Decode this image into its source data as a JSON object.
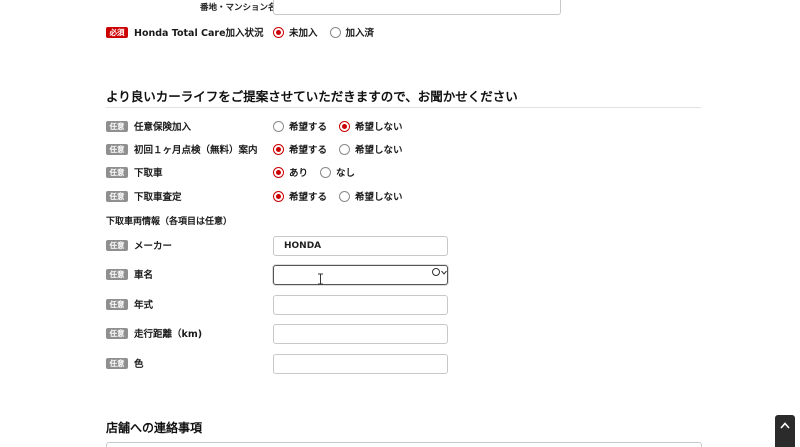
{
  "address": {
    "label": "番地・マンション名",
    "value": ""
  },
  "honda_care": {
    "badge": "必須",
    "label": "Honda Total Care加入状況",
    "options": [
      {
        "label": "未加入",
        "selected": true
      },
      {
        "label": "加入済",
        "selected": false
      }
    ]
  },
  "section": {
    "title": "より良いカーライフをご提案させていただきますので、お聞かせください"
  },
  "rows": [
    {
      "badge": "任意",
      "label": "任意保険加入",
      "options": [
        {
          "label": "希望する",
          "selected": false
        },
        {
          "label": "希望しない",
          "selected": true
        }
      ]
    },
    {
      "badge": "任意",
      "label": "初回１ヶ月点検（無料）案内",
      "options": [
        {
          "label": "希望する",
          "selected": true
        },
        {
          "label": "希望しない",
          "selected": false
        }
      ]
    },
    {
      "badge": "任意",
      "label": "下取車",
      "options": [
        {
          "label": "あり",
          "selected": true
        },
        {
          "label": "なし",
          "selected": false
        }
      ]
    },
    {
      "badge": "任意",
      "label": "下取車査定",
      "options": [
        {
          "label": "希望する",
          "selected": true
        },
        {
          "label": "希望しない",
          "selected": false
        }
      ]
    }
  ],
  "tradein": {
    "heading": "下取車両情報（各項目は任意）",
    "fields": [
      {
        "badge": "任意",
        "label": "メーカー",
        "value": "HONDA"
      },
      {
        "badge": "任意",
        "label": "車名",
        "value": ""
      },
      {
        "badge": "任意",
        "label": "年式",
        "value": ""
      },
      {
        "badge": "任意",
        "label": "走行距離（km)",
        "value": ""
      },
      {
        "badge": "任意",
        "label": "色",
        "value": ""
      }
    ]
  },
  "contact": {
    "title": "店舗への連絡事項"
  },
  "colors": {
    "required": "#cc0000",
    "optional": "#8f8f8f",
    "radio_selected": "#cc0000"
  },
  "icons": {
    "scroll_top": "chevron-up-icon",
    "cursor": "text-cursor-icon",
    "select": "chevron-down-icon"
  }
}
